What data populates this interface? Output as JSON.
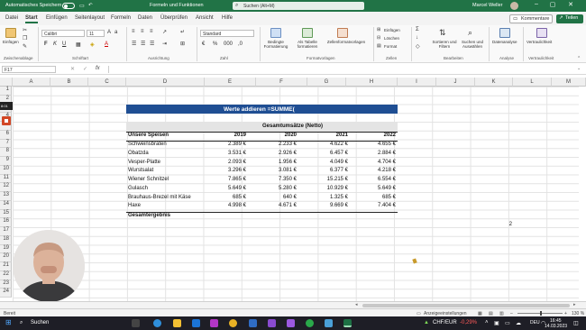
{
  "titlebar": {
    "autosave": "Automatisches Speichern",
    "file": "Formeln und Funktionen",
    "search": "Suchen (Alt+M)",
    "user": "Marcel Weller"
  },
  "menu": [
    "Datei",
    "Start",
    "Einfügen",
    "Seitenlayout",
    "Formeln",
    "Daten",
    "Überprüfen",
    "Ansicht",
    "Hilfe"
  ],
  "header_buttons": {
    "comments": "Kommentare",
    "share": "Teilen"
  },
  "ribbon": {
    "paste": "Einfügen",
    "clipboard": "Zwischenablage",
    "font_name": "Calibri",
    "font_size": "11",
    "font_group": "Schriftart",
    "align_group": "Ausrichtung",
    "number_format": "Standard",
    "number_group": "Zahl",
    "cond_format": "Bedingte Formatierung",
    "as_table": "Als Tabelle formatieren",
    "cell_styles": "Zellenformatvorlagen",
    "styles_group": "Formatvorlagen",
    "insert": "Einfügen",
    "delete": "Löschen",
    "format": "Format",
    "cells_group": "Zellen",
    "sort_filter": "Sortieren und Filtern",
    "find_select": "Suchen und Auswählen",
    "edit_group": "Bearbeiten",
    "data_analysis": "Datenanalyse",
    "analysis_group": "Analyse",
    "sensitivity": "Vertraulichkeit",
    "sensitivity_group": "Vertraulichkeit"
  },
  "formula_bar": {
    "name_box": "F17",
    "fx": "fx",
    "content": ""
  },
  "columns": [
    "A",
    "B",
    "C",
    "D",
    "E",
    "F",
    "G",
    "H",
    "I",
    "J",
    "K",
    "L",
    "M"
  ],
  "rows": [
    "1",
    "2",
    "3",
    "4",
    "5",
    "6",
    "7",
    "8",
    "9",
    "10",
    "11",
    "12",
    "13",
    "14",
    "15",
    "16",
    "17",
    "18",
    "19",
    "20",
    "21",
    "22",
    "23",
    "24"
  ],
  "sheet": {
    "banner": "Werte addieren  =SUMME(",
    "table_title": "Gesamtumsätze (Netto)",
    "header": [
      "Unsere Speisen",
      "2019",
      "2020",
      "2021",
      "2022"
    ],
    "items": [
      [
        "Schweinsbraten",
        "2.389 €",
        "2.233 €",
        "4.622 €",
        "4.655 €"
      ],
      [
        "Obatzda",
        "3.531 €",
        "2.926 €",
        "6.457 €",
        "2.884 €"
      ],
      [
        "Vesper-Platte",
        "2.093 €",
        "1.956 €",
        "4.049 €",
        "4.704 €"
      ],
      [
        "Wurstsalat",
        "3.296 €",
        "3.081 €",
        "6.377 €",
        "4.218 €"
      ],
      [
        "Wiener Schnitzel",
        "7.865 €",
        "7.350 €",
        "15.215 €",
        "6.554 €"
      ],
      [
        "Gulasch",
        "5.649 €",
        "5.280 €",
        "10.929 €",
        "5.649 €"
      ],
      [
        "Brauhaus-Brezel mit Käse",
        "685 €",
        "640 €",
        "1.325 €",
        "685 €"
      ],
      [
        "Haxe",
        "4.998 €",
        "4.671 €",
        "9.669 €",
        "7.404 €"
      ]
    ],
    "total_label": "Gesamtergebnis",
    "k16": "2"
  },
  "side_tag": "8:01",
  "status": {
    "ready": "Bereit",
    "display": "Anzeigeeinstellungen",
    "zoom": "130 %"
  },
  "taskbar": {
    "search": "Suchen",
    "ticker": "CHF/EUR",
    "change": "-0,29%",
    "lang": "DEU",
    "time": "16:45",
    "date": "14.03.2023"
  },
  "colors": {
    "excel_green": "#217346",
    "banner_blue": "#1f4e93",
    "ticker_red": "#ff5a5a"
  }
}
